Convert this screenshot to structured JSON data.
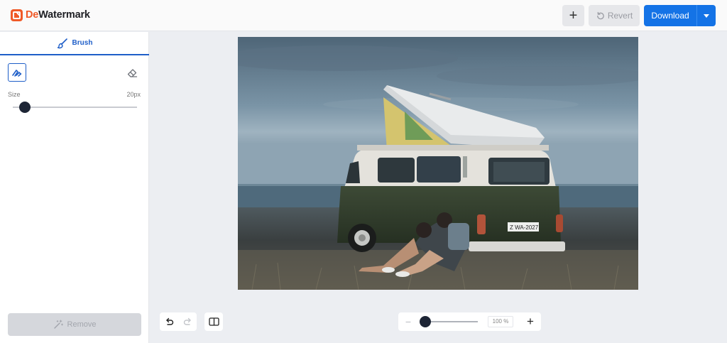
{
  "app": {
    "logo_prefix": "De",
    "logo_suffix": "Watermark",
    "brand_color": "#f05a28",
    "accent_color": "#1473e6"
  },
  "header": {
    "add_label": "+",
    "revert_label": "Revert",
    "download_label": "Download"
  },
  "sidebar": {
    "tab_label": "Brush",
    "size_label": "Size",
    "size_value": "20px",
    "size_level_percent": 10,
    "remove_label": "Remove"
  },
  "canvas": {
    "image_icon": "camper-van-photo",
    "plate_text": "Z WA-2027"
  },
  "zoom": {
    "minus_label": "−",
    "value": "100 %",
    "plus_label": "+",
    "level_percent": 0
  }
}
